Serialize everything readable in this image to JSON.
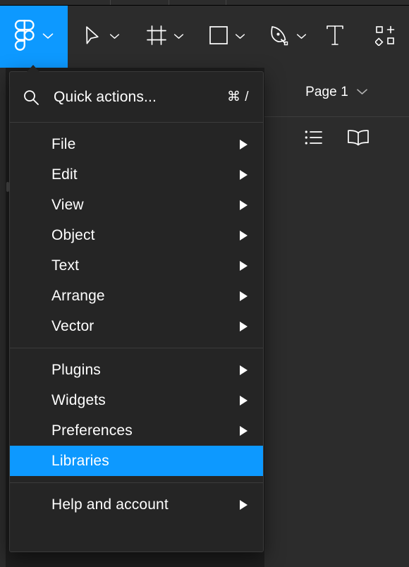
{
  "app": {
    "name": "Figma",
    "accent_color": "#0d99ff",
    "background_color": "#1e1e1e",
    "toolbar_color": "#2c2c2c",
    "menu_color": "#252525"
  },
  "toolbar": {
    "menu_button": {
      "icon": "figma-logo-icon",
      "chevron": "chevron-down-icon"
    },
    "tools": [
      {
        "name": "move-tool",
        "icon": "cursor-arrow-icon",
        "has_chevron": true
      },
      {
        "name": "frame-tool",
        "icon": "frame-icon",
        "has_chevron": true
      },
      {
        "name": "shape-tool",
        "icon": "rectangle-icon",
        "has_chevron": true
      },
      {
        "name": "pen-tool",
        "icon": "pen-icon",
        "has_chevron": true
      },
      {
        "name": "text-tool",
        "icon": "text-t-icon",
        "has_chevron": false
      },
      {
        "name": "actions-tool",
        "icon": "components-actions-icon",
        "has_chevron": false
      }
    ]
  },
  "right_panel": {
    "page_selector": {
      "label": "Page 1",
      "chevron": "chevron-down-icon"
    },
    "icons": [
      {
        "name": "layers-list-icon"
      },
      {
        "name": "book-icon"
      }
    ]
  },
  "menu": {
    "quick_actions": {
      "icon": "search-icon",
      "label": "Quick actions...",
      "shortcut": "⌘ /"
    },
    "groups": [
      {
        "items": [
          {
            "label": "File",
            "has_submenu": true,
            "selected": false
          },
          {
            "label": "Edit",
            "has_submenu": true,
            "selected": false
          },
          {
            "label": "View",
            "has_submenu": true,
            "selected": false
          },
          {
            "label": "Object",
            "has_submenu": true,
            "selected": false
          },
          {
            "label": "Text",
            "has_submenu": true,
            "selected": false
          },
          {
            "label": "Arrange",
            "has_submenu": true,
            "selected": false
          },
          {
            "label": "Vector",
            "has_submenu": true,
            "selected": false
          }
        ]
      },
      {
        "items": [
          {
            "label": "Plugins",
            "has_submenu": true,
            "selected": false
          },
          {
            "label": "Widgets",
            "has_submenu": true,
            "selected": false
          },
          {
            "label": "Preferences",
            "has_submenu": true,
            "selected": false
          },
          {
            "label": "Libraries",
            "has_submenu": false,
            "selected": true
          }
        ]
      },
      {
        "items": [
          {
            "label": "Help and account",
            "has_submenu": true,
            "selected": false
          }
        ]
      }
    ]
  }
}
